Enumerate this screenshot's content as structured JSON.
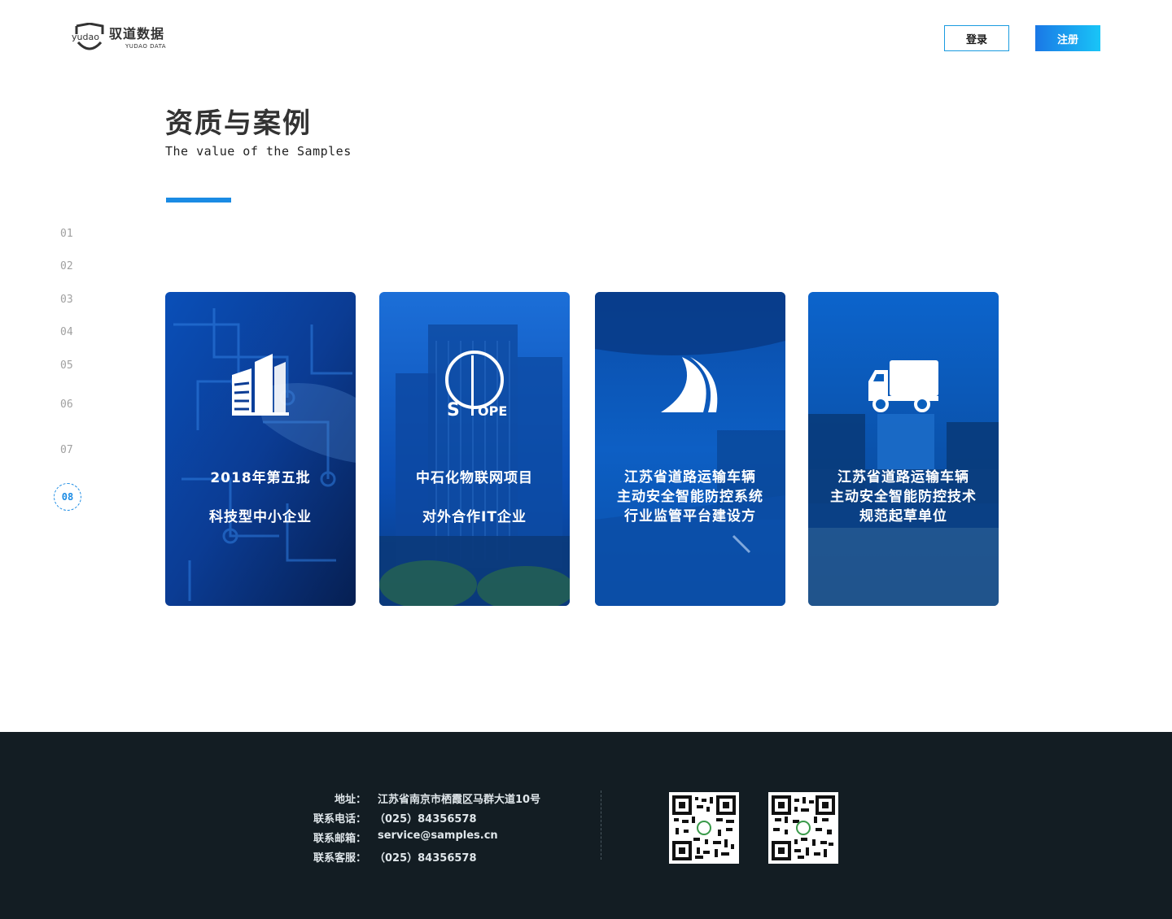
{
  "header": {
    "logo_cn": "驭道数据",
    "logo_en": "YUDAO DATA",
    "logo_mark": "yudao",
    "login_label": "登录",
    "register_label": "注册"
  },
  "section": {
    "title": "资质与案例",
    "subtitle": "The value of the Samples"
  },
  "nav": {
    "items": [
      "01",
      "02",
      "03",
      "04",
      "05",
      "06",
      "07"
    ],
    "active": "08"
  },
  "cards": [
    {
      "icon": "building-icon",
      "line1": "2018年第五批",
      "line2": "科技型中小企业",
      "line3": ""
    },
    {
      "icon": "sinopec-logo-icon",
      "line1": "中石化物联网项目",
      "line2": "对外合作IT企业",
      "line3": ""
    },
    {
      "icon": "road-icon",
      "line1": "江苏省道路运输车辆",
      "line2": "主动安全智能防控系统",
      "line3": "行业监管平台建设方"
    },
    {
      "icon": "truck-icon",
      "line1": "江苏省道路运输车辆",
      "line2": "主动安全智能防控技术",
      "line3": "规范起草单位"
    }
  ],
  "footer": {
    "address_label": "地址：",
    "address": "江苏省南京市栖霞区马群大道10号",
    "phone_label": "联系电话：",
    "phone": "（025）84356578",
    "email_label": "联系邮箱：",
    "email": "service@samples.cn",
    "service_label": "联系客服：",
    "service": "（025）84356578"
  },
  "colors": {
    "accent": "#1a8be4",
    "footer_bg": "#131d23",
    "card_blue": "#0d5fc4"
  }
}
